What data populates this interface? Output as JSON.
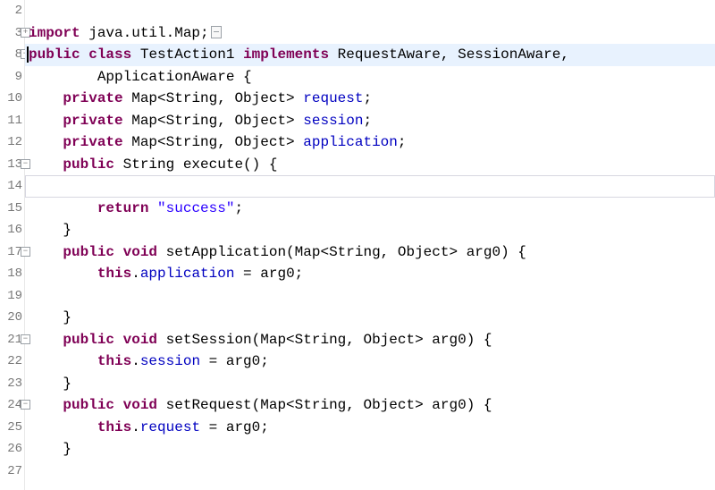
{
  "editor": {
    "line_height_px": 24.5,
    "highlighted_line_index": 1,
    "current_line_index": 6,
    "lines": [
      {
        "num": 2,
        "fold": "",
        "tokens": []
      },
      {
        "num": 3,
        "fold": "plus",
        "tokens": [
          {
            "t": "kw",
            "s": "import"
          },
          {
            "t": "plain",
            "s": " java.util.Map;"
          },
          {
            "t": "collapsed",
            "s": ""
          }
        ]
      },
      {
        "num": 8,
        "fold": "minus",
        "tokens": [
          {
            "t": "kw",
            "s": "public"
          },
          {
            "t": "plain",
            "s": " "
          },
          {
            "t": "kw",
            "s": "class"
          },
          {
            "t": "plain",
            "s": " TestAction1 "
          },
          {
            "t": "kw",
            "s": "implements"
          },
          {
            "t": "plain",
            "s": " RequestAware, SessionAware,"
          }
        ]
      },
      {
        "num": 9,
        "fold": "",
        "tokens": [
          {
            "t": "plain",
            "s": "        ApplicationAware {"
          }
        ]
      },
      {
        "num": 10,
        "fold": "",
        "tokens": [
          {
            "t": "plain",
            "s": "    "
          },
          {
            "t": "kw",
            "s": "private"
          },
          {
            "t": "plain",
            "s": " Map<String, Object> "
          },
          {
            "t": "field",
            "s": "request"
          },
          {
            "t": "plain",
            "s": ";"
          }
        ]
      },
      {
        "num": 11,
        "fold": "",
        "tokens": [
          {
            "t": "plain",
            "s": "    "
          },
          {
            "t": "kw",
            "s": "private"
          },
          {
            "t": "plain",
            "s": " Map<String, Object> "
          },
          {
            "t": "field",
            "s": "session"
          },
          {
            "t": "plain",
            "s": ";"
          }
        ]
      },
      {
        "num": 12,
        "fold": "",
        "tokens": [
          {
            "t": "plain",
            "s": "    "
          },
          {
            "t": "kw",
            "s": "private"
          },
          {
            "t": "plain",
            "s": " Map<String, Object> "
          },
          {
            "t": "field",
            "s": "application"
          },
          {
            "t": "plain",
            "s": ";"
          }
        ]
      },
      {
        "num": 13,
        "fold": "minus",
        "tokens": [
          {
            "t": "plain",
            "s": "    "
          },
          {
            "t": "kw",
            "s": "public"
          },
          {
            "t": "plain",
            "s": " String execute() {"
          }
        ]
      },
      {
        "num": 14,
        "fold": "",
        "tokens": []
      },
      {
        "num": 15,
        "fold": "",
        "tokens": [
          {
            "t": "plain",
            "s": "        "
          },
          {
            "t": "kw",
            "s": "return"
          },
          {
            "t": "plain",
            "s": " "
          },
          {
            "t": "str",
            "s": "\"success\""
          },
          {
            "t": "plain",
            "s": ";"
          }
        ]
      },
      {
        "num": 16,
        "fold": "",
        "tokens": [
          {
            "t": "plain",
            "s": "    }"
          }
        ]
      },
      {
        "num": 17,
        "fold": "minus",
        "tokens": [
          {
            "t": "plain",
            "s": "    "
          },
          {
            "t": "kw",
            "s": "public"
          },
          {
            "t": "plain",
            "s": " "
          },
          {
            "t": "kw",
            "s": "void"
          },
          {
            "t": "plain",
            "s": " setApplication(Map<String, Object> arg0) {"
          }
        ]
      },
      {
        "num": 18,
        "fold": "",
        "tokens": [
          {
            "t": "plain",
            "s": "        "
          },
          {
            "t": "kw",
            "s": "this"
          },
          {
            "t": "plain",
            "s": "."
          },
          {
            "t": "field",
            "s": "application"
          },
          {
            "t": "plain",
            "s": " = arg0;"
          }
        ]
      },
      {
        "num": 19,
        "fold": "",
        "tokens": []
      },
      {
        "num": 20,
        "fold": "",
        "tokens": [
          {
            "t": "plain",
            "s": "    }"
          }
        ]
      },
      {
        "num": 21,
        "fold": "minus",
        "tokens": [
          {
            "t": "plain",
            "s": "    "
          },
          {
            "t": "kw",
            "s": "public"
          },
          {
            "t": "plain",
            "s": " "
          },
          {
            "t": "kw",
            "s": "void"
          },
          {
            "t": "plain",
            "s": " setSession(Map<String, Object> arg0) {"
          }
        ]
      },
      {
        "num": 22,
        "fold": "",
        "tokens": [
          {
            "t": "plain",
            "s": "        "
          },
          {
            "t": "kw",
            "s": "this"
          },
          {
            "t": "plain",
            "s": "."
          },
          {
            "t": "field",
            "s": "session"
          },
          {
            "t": "plain",
            "s": " = arg0;"
          }
        ]
      },
      {
        "num": 23,
        "fold": "",
        "tokens": [
          {
            "t": "plain",
            "s": "    }"
          }
        ]
      },
      {
        "num": 24,
        "fold": "minus",
        "tokens": [
          {
            "t": "plain",
            "s": "    "
          },
          {
            "t": "kw",
            "s": "public"
          },
          {
            "t": "plain",
            "s": " "
          },
          {
            "t": "kw",
            "s": "void"
          },
          {
            "t": "plain",
            "s": " setRequest(Map<String, Object> arg0) {"
          }
        ]
      },
      {
        "num": 25,
        "fold": "",
        "tokens": [
          {
            "t": "plain",
            "s": "        "
          },
          {
            "t": "kw",
            "s": "this"
          },
          {
            "t": "plain",
            "s": "."
          },
          {
            "t": "field",
            "s": "request"
          },
          {
            "t": "plain",
            "s": " = arg0;"
          }
        ]
      },
      {
        "num": 26,
        "fold": "",
        "tokens": [
          {
            "t": "plain",
            "s": "    }"
          }
        ]
      },
      {
        "num": 27,
        "fold": "",
        "tokens": []
      }
    ]
  }
}
